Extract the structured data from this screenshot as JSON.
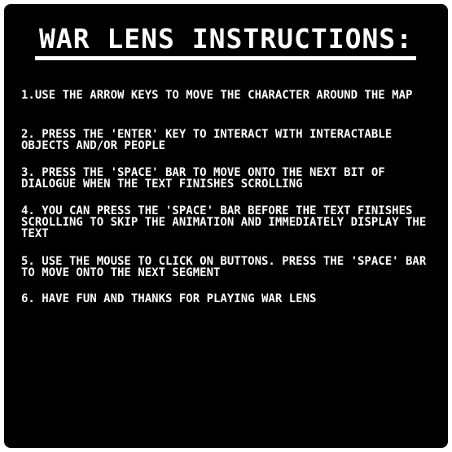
{
  "screen": {
    "title": "WAR LENS INSTRUCTIONS:",
    "background_color": "#000000",
    "text_color": "#ffffff"
  },
  "instructions": [
    "1.USE THE ARROW KEYS TO MOVE THE CHARACTER AROUND THE MAP",
    "2. PRESS THE 'ENTER' KEY TO INTERACT WITH INTERACTABLE OBJECTS AND/OR PEOPLE",
    "3. PRESS THE 'SPACE' BAR TO MOVE ONTO THE NEXT BIT OF DIALOGUE WHEN THE TEXT FINISHES SCROLLING",
    "4. YOU CAN PRESS THE 'SPACE' BAR BEFORE THE TEXT FINISHES SCROLLING TO SKIP THE ANIMATION AND IMMEDIATELY DISPLAY THE TEXT",
    "5. USE THE MOUSE TO CLICK ON BUTTONS. PRESS THE 'SPACE' BAR TO MOVE ONTO THE NEXT SEGMENT",
    "6. HAVE FUN AND THANKS FOR PLAYING WAR LENS"
  ]
}
